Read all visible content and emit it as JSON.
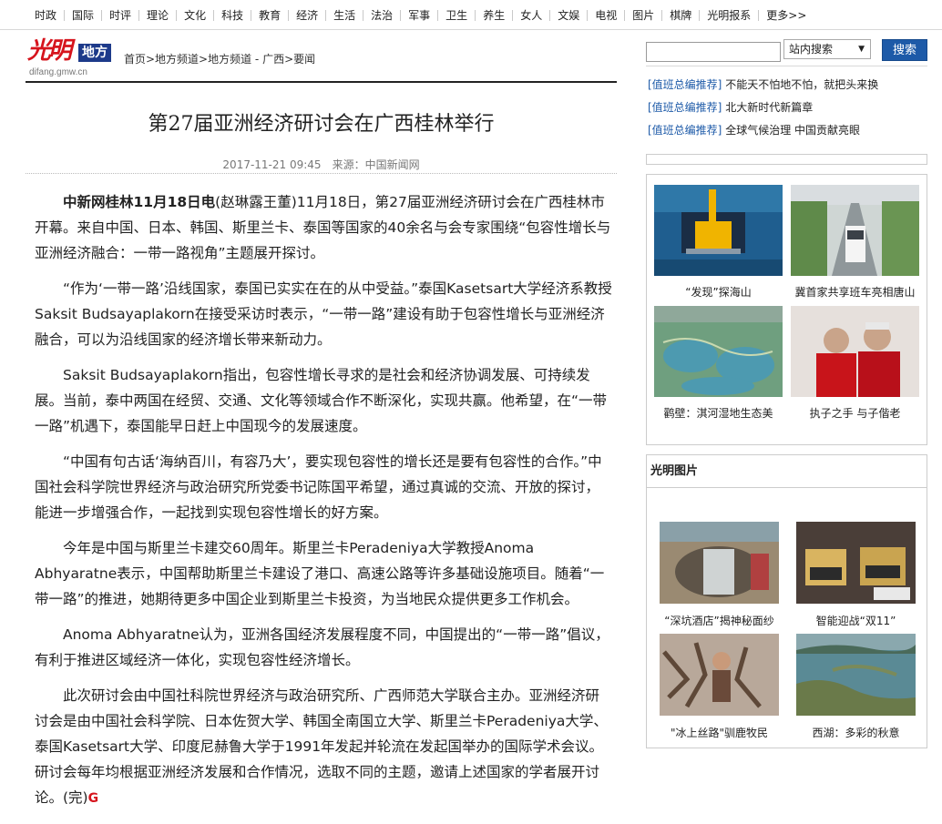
{
  "topnav": [
    "时政",
    "国际",
    "时评",
    "理论",
    "文化",
    "科技",
    "教育",
    "经济",
    "生活",
    "法治",
    "军事",
    "卫生",
    "养生",
    "女人",
    "文娱",
    "电视",
    "图片",
    "棋牌",
    "光明报系",
    "更多>>"
  ],
  "logo": {
    "mark": "光明",
    "box": "地方",
    "url": "difang.gmw.cn"
  },
  "breadcrumb": "首页>地方频道>地方频道 - 广西>要闻",
  "article": {
    "title": "第27届亚洲经济研讨会在广西桂林举行",
    "date": "2017-11-21 09:45",
    "source": "来源：中国新闻网",
    "lead_bold": "中新网桂林11月18日电",
    "paragraphs": [
      "(赵琳露王董)11月18日，第27届亚洲经济研讨会在广西桂林市开幕。来自中国、日本、韩国、斯里兰卡、泰国等国家的40余名与会专家围绕“包容性增长与亚洲经济融合：一带一路视角”主题展开探讨。",
      "“作为‘一带一路’沿线国家，泰国已实实在在的从中受益。”泰国Kasetsart大学经济系教授Saksit Budsayaplakorn在接受采访时表示，“一带一路”建设有助于包容性增长与亚洲经济融合，可以为沿线国家的经济增长带来新动力。",
      "Saksit Budsayaplakorn指出，包容性增长寻求的是社会和经济协调发展、可持续发展。当前，泰中两国在经贸、交通、文化等领域合作不断深化，实现共赢。他希望，在“一带一路”机遇下，泰国能早日赶上中国现今的发展速度。",
      "“中国有句古话‘海纳百川，有容乃大’，要实现包容性的增长还是要有包容性的合作。”中国社会科学院世界经济与政治研究所党委书记陈国平希望，通过真诚的交流、开放的探讨，能进一步增强合作，一起找到实现包容性增长的好方案。",
      "今年是中国与斯里兰卡建交60周年。斯里兰卡Peradeniya大学教授Anoma Abhyaratne表示，中国帮助斯里兰卡建设了港口、高速公路等许多基础设施项目。随着“一带一路”的推进，她期待更多中国企业到斯里兰卡投资，为当地民众提供更多工作机会。",
      "Anoma Abhyaratne认为，亚洲各国经济发展程度不同，中国提出的“一带一路”倡议，有利于推进区域经济一体化，实现包容性经济增长。",
      "此次研讨会由中国社科院世界经济与政治研究所、广西师范大学联合主办。亚洲经济研讨会是由中国社会科学院、日本佐贺大学、韩国全南国立大学、斯里兰卡Peradeniya大学、泰国Kasetsart大学、印度尼赫鲁大学于1991年发起并轮流在发起国举办的国际学术会议。研讨会每年均根据亚洲经济发展和合作情况，选取不同的主题，邀请上述国家的学者展开讨论。(完)"
    ],
    "end_mark": "G"
  },
  "search": {
    "value": "",
    "select": "站内搜索",
    "button": "搜索"
  },
  "recommend": [
    {
      "tag": "[值班总编推荐]",
      "text": "不能天不怕地不怕，就把头来换"
    },
    {
      "tag": "[值班总编推荐]",
      "text": "北大新时代新篇章"
    },
    {
      "tag": "[值班总编推荐]",
      "text": "全球气候治理 中国贡献亮眼"
    }
  ],
  "photos1": [
    {
      "caption": "“发现”探海山"
    },
    {
      "caption": "冀首家共享班车亮相唐山"
    },
    {
      "caption": "鹳壁：淇河湿地生态美"
    },
    {
      "caption": "执子之手 与子偕老"
    }
  ],
  "photos2_head": "光明图片",
  "photos2": [
    {
      "caption": "“深坑酒店”揭神秘面纱"
    },
    {
      "caption": "智能迎战“双11”"
    },
    {
      "caption": "\"冰上丝路\"驯鹿牧民"
    },
    {
      "caption": "西湖：多彩的秋意"
    }
  ],
  "colors": {
    "brand_red": "#d6141d",
    "brand_blue": "#1d3a8a",
    "link_blue": "#1d5aa8"
  }
}
